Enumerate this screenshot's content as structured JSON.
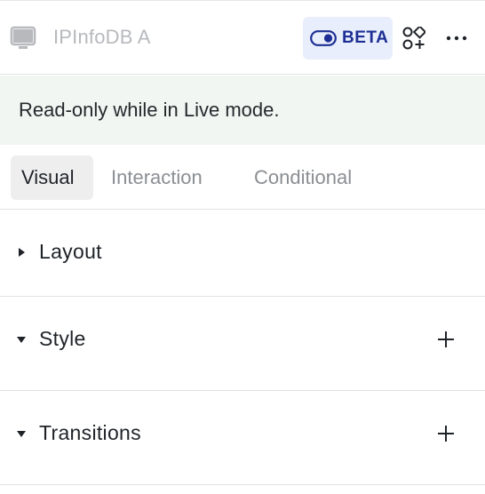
{
  "header": {
    "element_name": "IPInfoDB A",
    "badge_label": "BETA",
    "icons": [
      "monitor-icon",
      "toggle-icon",
      "components-icon",
      "more-icon"
    ],
    "accent_color": "#1d2e94"
  },
  "notice": {
    "text": "Read-only while in Live mode."
  },
  "tabs": [
    {
      "label": "Visual",
      "active": true
    },
    {
      "label": "Interaction",
      "active": false
    },
    {
      "label": "Conditional",
      "active": false
    }
  ],
  "sections": [
    {
      "title": "Layout",
      "expanded": false,
      "has_add": false
    },
    {
      "title": "Style",
      "expanded": true,
      "has_add": true
    },
    {
      "title": "Transitions",
      "expanded": true,
      "has_add": true
    }
  ]
}
